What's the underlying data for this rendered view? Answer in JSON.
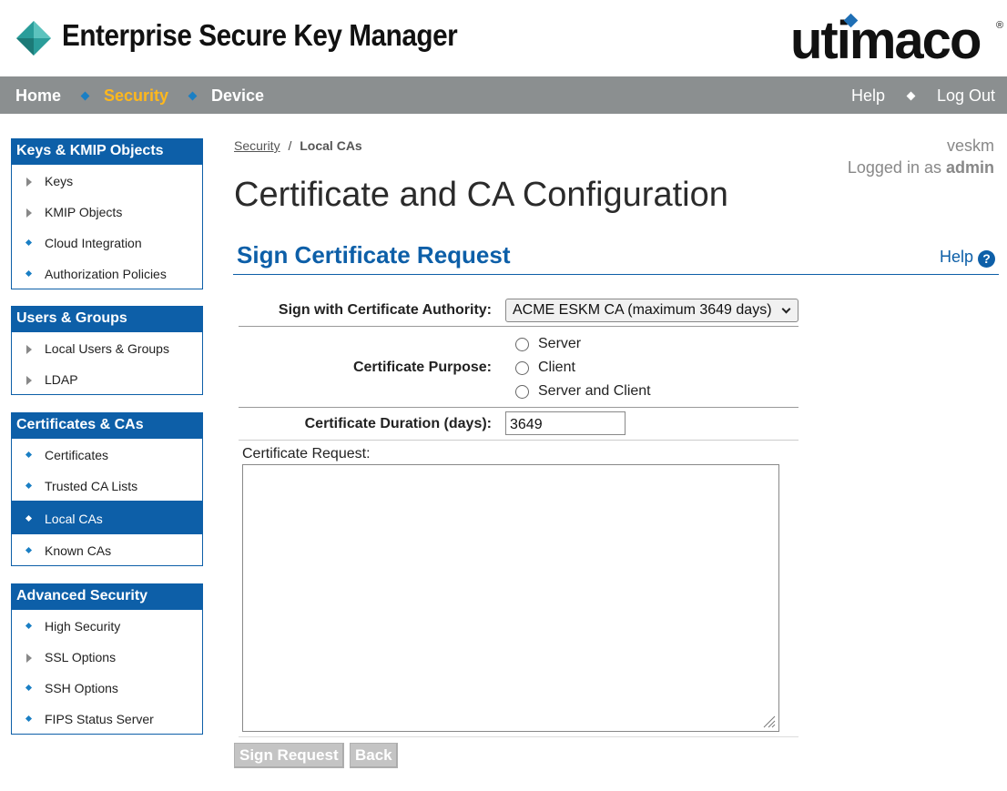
{
  "header": {
    "app_title": "Enterprise Secure Key Manager",
    "brand": "utimaco",
    "brand_reg": "®"
  },
  "topnav": {
    "left": [
      "Home",
      "Security",
      "Device"
    ],
    "active": "Security",
    "right": [
      "Help",
      "Log Out"
    ]
  },
  "sidebar": {
    "groups": [
      {
        "title": "Keys & KMIP Objects",
        "items": [
          {
            "label": "Keys",
            "bullet": "triangle"
          },
          {
            "label": "KMIP Objects",
            "bullet": "triangle"
          },
          {
            "label": "Cloud Integration",
            "bullet": "diamond"
          },
          {
            "label": "Authorization Policies",
            "bullet": "diamond"
          }
        ]
      },
      {
        "title": "Users & Groups",
        "items": [
          {
            "label": "Local Users & Groups",
            "bullet": "triangle"
          },
          {
            "label": "LDAP",
            "bullet": "triangle"
          }
        ]
      },
      {
        "title": "Certificates & CAs",
        "items": [
          {
            "label": "Certificates",
            "bullet": "diamond"
          },
          {
            "label": "Trusted CA Lists",
            "bullet": "diamond"
          },
          {
            "label": "Local CAs",
            "bullet": "diamond",
            "active": true
          },
          {
            "label": "Known CAs",
            "bullet": "diamond"
          }
        ]
      },
      {
        "title": "Advanced Security",
        "items": [
          {
            "label": "High Security",
            "bullet": "diamond"
          },
          {
            "label": "SSL Options",
            "bullet": "triangle"
          },
          {
            "label": "SSH Options",
            "bullet": "diamond"
          },
          {
            "label": "FIPS Status Server",
            "bullet": "diamond"
          }
        ]
      }
    ]
  },
  "breadcrumb": {
    "parent": "Security",
    "separator": "/",
    "current": "Local CAs"
  },
  "user": {
    "hostname": "veskm",
    "logged_in_prefix": "Logged in as",
    "username": "admin"
  },
  "page_title": "Certificate and CA Configuration",
  "section": {
    "title": "Sign Certificate Request",
    "help_label": "Help",
    "help_icon": "?"
  },
  "form": {
    "ca_label": "Sign with Certificate Authority:",
    "ca_value": "ACME ESKM CA (maximum 3649 days)",
    "purpose_label": "Certificate Purpose:",
    "purpose_options": [
      "Server",
      "Client",
      "Server and Client"
    ],
    "duration_label": "Certificate Duration (days):",
    "duration_value": "3649",
    "request_label": "Certificate Request:",
    "request_value": ""
  },
  "buttons": {
    "sign": "Sign Request",
    "back": "Back"
  },
  "colors": {
    "primary_blue": "#0d5fa8",
    "nav_gray": "#8b8f90",
    "active_nav": "#ffb81c",
    "logo_teal": "#2a9d9a",
    "button_disabled": "#c4c4c4"
  }
}
